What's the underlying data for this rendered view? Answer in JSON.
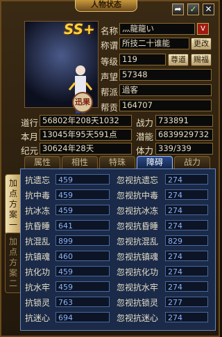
{
  "window": {
    "title": "人物状态"
  },
  "badges": {
    "rank": "SS+",
    "seal": "迅果"
  },
  "info": {
    "name_label": "名称",
    "name_value": "灬龍龍い",
    "title_label": "称谓",
    "title_value": "所技二十谁能",
    "change_btn": "更改",
    "level_label": "等级",
    "level_value": "119",
    "respect_btn": "尊道",
    "gift_btn": "赐福",
    "prestige_label": "声望",
    "prestige_value": "57348",
    "sect_label": "帮派",
    "sect_value": "過客",
    "contrib_label": "帮贡",
    "contrib_value": "164707"
  },
  "stats": {
    "daoxing_label": "道行",
    "daoxing_value": "56802年208天1032",
    "power_label": "战力",
    "power_value": "733891",
    "month_label": "本月",
    "month_value": "13045年95天591点",
    "potential_label": "潜能",
    "potential_value": "6839929732",
    "era_label": "纪元",
    "era_value": "30624年28天",
    "stamina_label": "体力",
    "stamina_value": "339/339"
  },
  "tabs": [
    "属性",
    "相性",
    "特珠",
    "障碍",
    "战力"
  ],
  "active_tab": "障碍",
  "side_tabs": [
    "加点方案一",
    "加点方案二"
  ],
  "resist_rows": [
    {
      "left_label": "抗遗忘",
      "left_value": "459",
      "right_label": "忽视抗遗忘",
      "right_value": "274"
    },
    {
      "left_label": "抗中毒",
      "left_value": "459",
      "right_label": "忽视抗中毒",
      "right_value": "274"
    },
    {
      "left_label": "抗冰冻",
      "left_value": "459",
      "right_label": "忽视抗冰冻",
      "right_value": "274"
    },
    {
      "left_label": "抗昏睡",
      "left_value": "641",
      "right_label": "忽视抗昏睡",
      "right_value": "274"
    },
    {
      "left_label": "抗混乱",
      "left_value": "899",
      "right_label": "忽视抗混乱",
      "right_value": "829"
    },
    {
      "left_label": "抗镇魂",
      "left_value": "460",
      "right_label": "忽视抗镇魂",
      "right_value": "274"
    },
    {
      "left_label": "抗化功",
      "left_value": "459",
      "right_label": "忽视抗化功",
      "right_value": "274"
    },
    {
      "left_label": "抗水牢",
      "left_value": "459",
      "right_label": "忽视抗水牢",
      "right_value": "274"
    },
    {
      "left_label": "抗锁灵",
      "left_value": "763",
      "right_label": "忽视抗锁灵",
      "right_value": "277"
    },
    {
      "left_label": "抗迷心",
      "left_value": "694",
      "right_label": "忽视抗迷心",
      "right_value": "274"
    }
  ],
  "colors": {
    "accent": "#8ab4ff",
    "panel": "#1a2a48",
    "gold": "#c99a3c"
  }
}
